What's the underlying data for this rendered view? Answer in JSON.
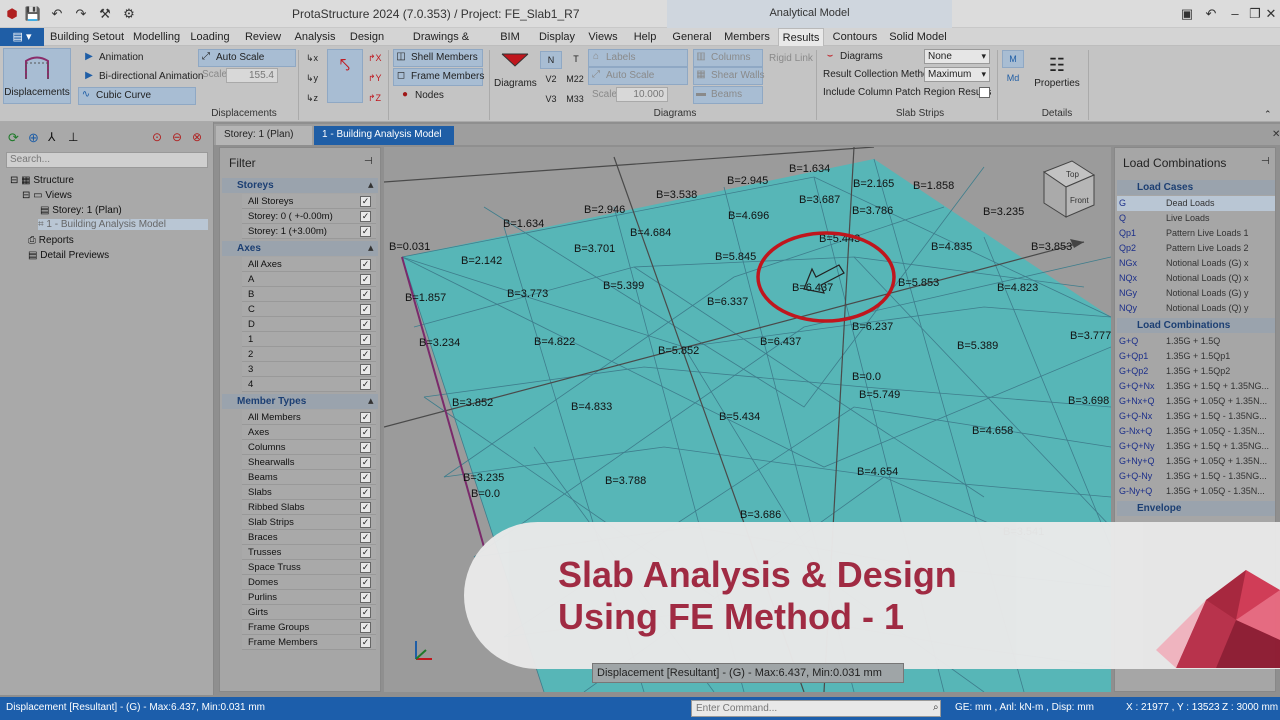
{
  "app": {
    "title": "ProtaStructure 2024 (7.0.353) / Project: FE_Slab1_R7",
    "context_band": "Analytical Model"
  },
  "tabs": [
    "Building Setout",
    "Modelling",
    "Loading",
    "Review",
    "Analysis",
    "Design",
    "Drawings & Reports",
    "BIM",
    "Display",
    "Views",
    "Help",
    "General",
    "Members",
    "Results",
    "Contours",
    "Solid Model"
  ],
  "active_tab": "Results",
  "ribbon": {
    "displacements": "Displacements",
    "animation": "Animation",
    "bidir": "Bi-directional Animation",
    "cubic": "Cubic Curve",
    "auto_scale": "Auto Scale",
    "scale_label": "Scale",
    "scale_value": "155.4",
    "group_displacements": "Displacements",
    "shell_members": "Shell Members",
    "frame_members": "Frame Members",
    "nodes": "Nodes",
    "diagrams_btn": "Diagrams",
    "forces": {
      "n": "N",
      "t": "T",
      "v2": "V2",
      "m22": "M22",
      "v3": "V3",
      "m33": "M33"
    },
    "labels": "Labels",
    "auto_scale2": "Auto Scale",
    "scale2_label": "Scale",
    "scale2_value": "10.000",
    "columns": "Columns",
    "shear_walls": "Shear Walls",
    "beams": "Beams",
    "rigid_link": "Rigid Link",
    "group_diagrams": "Diagrams",
    "diagrams_label": "Diagrams",
    "diagrams_value": "None",
    "collection_label": "Result Collection Method",
    "collection_value": "Maximum",
    "include_label": "Include Column Patch Region Results",
    "group_slab": "Slab Strips",
    "m_btn": "M",
    "md_btn": "Md",
    "properties": "Properties",
    "group_details": "Details"
  },
  "tree": {
    "search_placeholder": "Search...",
    "items": [
      "Structure",
      "Views",
      "Storey: 1 (Plan)",
      "1 - Building Analysis Model",
      "Reports",
      "Detail Previews"
    ]
  },
  "doc_tabs": [
    "Storey: 1 (Plan)",
    "1 - Building Analysis Model"
  ],
  "filter": {
    "title": "Filter",
    "storeys_title": "Storeys",
    "storeys": [
      "All Storeys",
      "Storey: 0 ( +-0.00m)",
      "Storey: 1 (+3.00m)"
    ],
    "axes_title": "Axes",
    "axes": [
      "All Axes",
      "A",
      "B",
      "C",
      "D",
      "1",
      "2",
      "3",
      "4"
    ],
    "member_types_title": "Member Types",
    "member_types": [
      "All Members",
      "Axes",
      "Columns",
      "Shearwalls",
      "Beams",
      "Slabs",
      "Ribbed Slabs",
      "Slab Strips",
      "Braces",
      "Trusses",
      "Space Truss",
      "Domes",
      "Purlins",
      "Girts",
      "Frame Groups",
      "Frame Members"
    ]
  },
  "viewport": {
    "labels": [
      "B=1.634",
      "B=2.945",
      "B=3.538",
      "B=2.165",
      "B=1.858",
      "B=3.687",
      "B=2.946",
      "B=3.235",
      "B=1.634",
      "B=4.696",
      "B=3.786",
      "B=4.684",
      "B=5.443",
      "B=4.835",
      "B=3.853",
      "B=0.031",
      "B=3.701",
      "B=5.845",
      "B=2.142",
      "B=6.437",
      "B=5.853",
      "B=4.823",
      "B=5.399",
      "B=1.857",
      "B=3.773",
      "B=6.337",
      "B=6.237",
      "B=3.777",
      "B=4.822",
      "B=6.437",
      "B=5.389",
      "B=3.234",
      "B=5.852",
      "B=0.0",
      "B=5.749",
      "B=3.852",
      "B=3.698",
      "B=4.833",
      "B=5.434",
      "B=4.658",
      "B=4.654",
      "B=3.235",
      "B=3.788",
      "B=0.0",
      "B=3.686",
      "B=3.541"
    ],
    "status": "Displacement [Resultant] - (G) - Max:6.437, Min:0.031 mm",
    "cube_top": "Top",
    "cube_front": "Front"
  },
  "load_combinations": {
    "title": "Load Combinations",
    "cases_title": "Load Cases",
    "cases": [
      {
        "code": "G",
        "desc": "Dead Loads"
      },
      {
        "code": "Q",
        "desc": "Live Loads"
      },
      {
        "code": "Qp1",
        "desc": "Pattern Live Loads 1"
      },
      {
        "code": "Qp2",
        "desc": "Pattern Live Loads 2"
      },
      {
        "code": "NGx",
        "desc": "Notional Loads (G) x"
      },
      {
        "code": "NQx",
        "desc": "Notional Loads (Q) x"
      },
      {
        "code": "NGy",
        "desc": "Notional Loads (G) y"
      },
      {
        "code": "NQy",
        "desc": "Notional Loads (Q) y"
      }
    ],
    "combos_title": "Load Combinations",
    "combos": [
      {
        "code": "G+Q",
        "desc": "1.35G + 1.5Q"
      },
      {
        "code": "G+Qp1",
        "desc": "1.35G + 1.5Qp1"
      },
      {
        "code": "G+Qp2",
        "desc": "1.35G + 1.5Qp2"
      },
      {
        "code": "G+Q+Nx",
        "desc": "1.35G + 1.5Q + 1.35NG..."
      },
      {
        "code": "G+Nx+Q",
        "desc": "1.35G + 1.05Q + 1.35N..."
      },
      {
        "code": "G+Q-Nx",
        "desc": "1.35G + 1.5Q - 1.35NG..."
      },
      {
        "code": "G-Nx+Q",
        "desc": "1.35G + 1.05Q - 1.35N..."
      },
      {
        "code": "G+Q+Ny",
        "desc": "1.35G + 1.5Q + 1.35NG..."
      },
      {
        "code": "G+Ny+Q",
        "desc": "1.35G + 1.05Q + 1.35N..."
      },
      {
        "code": "G+Q-Ny",
        "desc": "1.35G + 1.5Q - 1.35NG..."
      },
      {
        "code": "G-Ny+Q",
        "desc": "1.35G + 1.05Q - 1.35N..."
      }
    ],
    "envelope_title": "Envelope"
  },
  "status": {
    "left": "Displacement [Resultant] - (G) - Max:6.437, Min:0.031 mm",
    "cmd_placeholder": "Enter Command...",
    "units": "GE: mm , Anl: kN-m , Disp: mm",
    "coords": "X : 21977 , Y : 13523",
    "z": "Z : 3000 mm"
  },
  "banner": {
    "line1": "Slab Analysis & Design",
    "line2": "Using FE Method - 1"
  },
  "colors": {
    "accent": "#1c5eab",
    "slab": "#57b6b7",
    "banner_text": "#a32740",
    "highlight": "#c0161d"
  }
}
